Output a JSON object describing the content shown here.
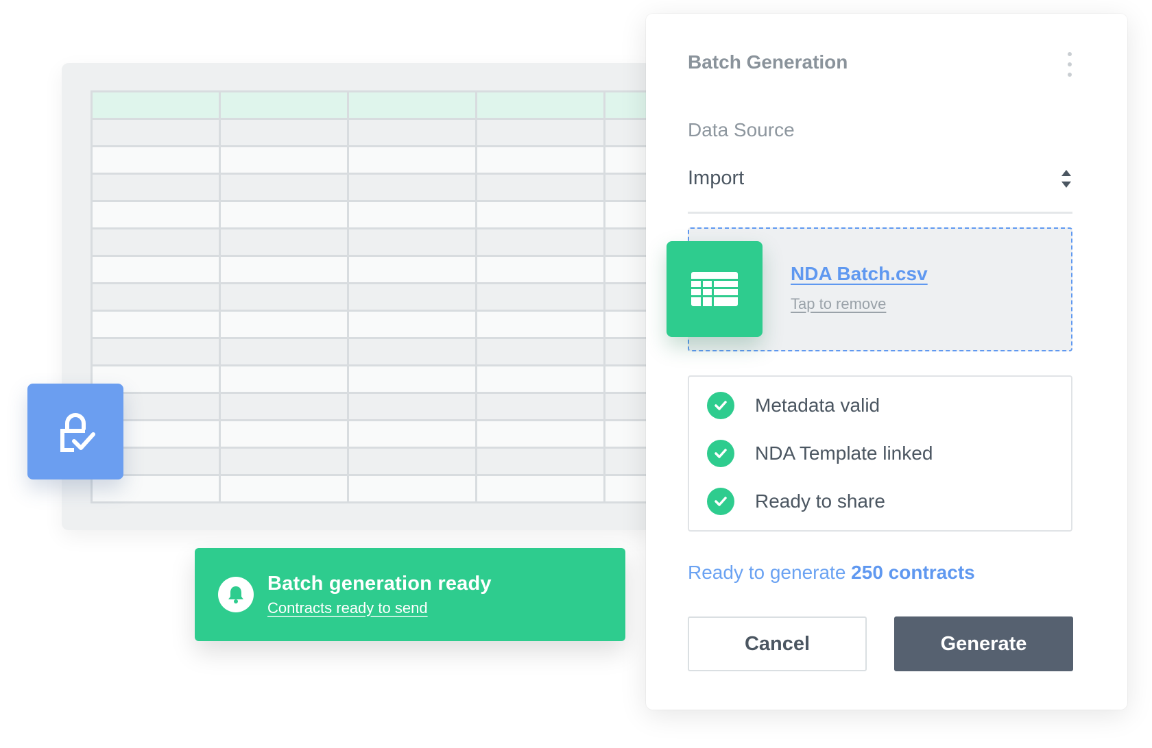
{
  "panel": {
    "title": "Batch Generation",
    "data_source": {
      "label": "Data Source",
      "selected": "Import"
    },
    "file": {
      "name": "NDA Batch.csv",
      "remove_label": "Tap to remove",
      "icon": "spreadsheet-icon"
    },
    "checks": [
      {
        "label": "Metadata valid",
        "status": "ok"
      },
      {
        "label": "NDA Template linked",
        "status": "ok"
      },
      {
        "label": "Ready to share",
        "status": "ok"
      }
    ],
    "summary": {
      "prefix": "Ready to generate",
      "count": "250 contracts"
    },
    "buttons": {
      "cancel": "Cancel",
      "generate": "Generate"
    }
  },
  "toast": {
    "title": "Batch generation ready",
    "subtitle": "Contracts ready to send",
    "icon": "bell-icon"
  },
  "lock_tile": {
    "icon": "lock-check-icon"
  },
  "colors": {
    "green": "#2ecc8e",
    "blue": "#5f98f0",
    "lock_blue": "#6b9ef0",
    "dark_button": "#566170"
  }
}
